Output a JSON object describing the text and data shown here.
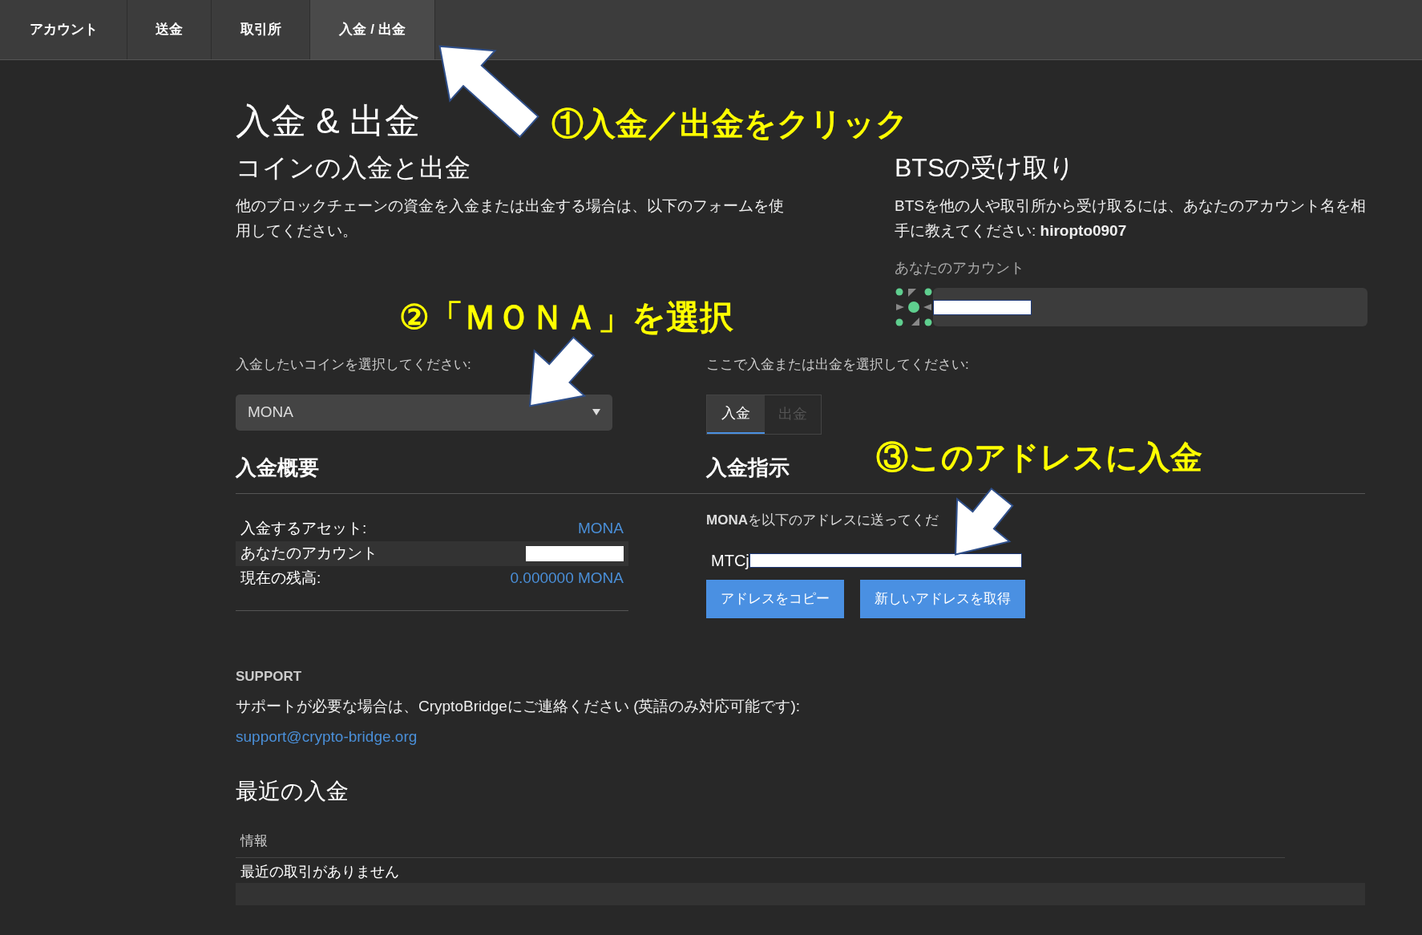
{
  "nav_tabs": [
    {
      "label": "アカウント",
      "selected": false
    },
    {
      "label": "送金",
      "selected": false
    },
    {
      "label": "取引所",
      "selected": false
    },
    {
      "label": "入金 / 出金",
      "selected": true
    }
  ],
  "page_title": "入金 & 出金",
  "coins_section": {
    "title": "コインの入金と出金",
    "description": "他のブロックチェーンの資金を入金または出金する場合は、以下のフォームを使用してください。"
  },
  "bts_section": {
    "title": "BTSの受け取り",
    "description": "BTSを他の人や取引所から受け取るには、あなたのアカウント名を相手に教えてください: **hiropto0907**",
    "account_label": "あなたのアカウント"
  },
  "coin_select": {
    "label": "入金したいコインを選択してください:",
    "value": "MONA"
  },
  "mode_select": {
    "label": "ここで入金または出金を選択してください:",
    "options": [
      {
        "label": "入金",
        "selected": true
      },
      {
        "label": "出金",
        "selected": false
      }
    ]
  },
  "summary": {
    "title": "入金概要",
    "rows": [
      {
        "label": "入金するアセット:",
        "value": "MONA"
      },
      {
        "label": "あなたのアカウント"
      },
      {
        "label": "現在の残高:",
        "value": "0.000000 MONA"
      }
    ]
  },
  "instructions": {
    "title": "入金指示",
    "text": "**MONA**を以下のアドレスに送ってくだ",
    "address": "MTCj",
    "buttons": [
      "アドレスをコピー",
      "新しいアドレスを取得"
    ]
  },
  "support": {
    "title": "SUPPORT",
    "text": "サポートが必要な場合は、CryptoBridgeにご連絡ください (英語のみ対応可能です):",
    "email": "support@crypto-bridge.org"
  },
  "recent_deposits": {
    "title": "最近の入金",
    "column": "情報",
    "empty_text": "最近の取引がありません"
  },
  "annotations": [
    {
      "text": "①入金／出金をクリック"
    },
    {
      "text": "②「ＭＯＮＡ」を選択"
    },
    {
      "text": "③このアドレスに入金"
    }
  ]
}
